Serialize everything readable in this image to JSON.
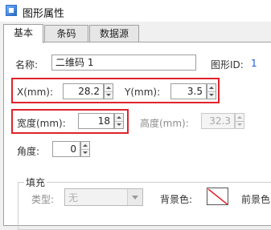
{
  "window": {
    "title": "图形属性",
    "icon": "app-window-icon"
  },
  "tabs": [
    {
      "label": "基本",
      "active": true
    },
    {
      "label": "条码",
      "active": false
    },
    {
      "label": "数据源",
      "active": false
    }
  ],
  "basic": {
    "name_label": "名称:",
    "name_value": "二维码 1",
    "shape_id_label": "图形ID:",
    "shape_id_value": "1",
    "x_label": "X(mm):",
    "x_value": "28.2",
    "y_label": "Y(mm):",
    "y_value": "3.5",
    "width_label": "宽度(mm):",
    "width_value": "18",
    "height_label": "高度(mm):",
    "height_value": "32.3",
    "angle_label": "角度:",
    "angle_value": "0"
  },
  "fill": {
    "group_label": "填充",
    "type_label": "类型:",
    "type_value": "无",
    "bg_color_label": "背景色:",
    "bg_color_value": "none",
    "fg_color_label": "前景色"
  },
  "colors": {
    "highlight": "#e0232b",
    "accent": "#1a5fd1"
  }
}
